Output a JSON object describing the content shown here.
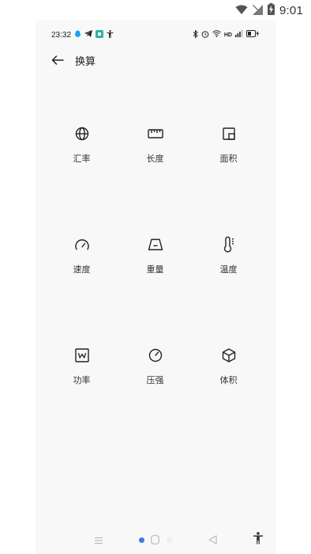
{
  "system_status": {
    "time": "9:01"
  },
  "inner_status": {
    "time": "23:32",
    "network": "HD"
  },
  "header": {
    "title": "换算"
  },
  "converters": [
    {
      "label": "汇率",
      "icon": "globe-icon"
    },
    {
      "label": "长度",
      "icon": "ruler-icon"
    },
    {
      "label": "面积",
      "icon": "area-icon"
    },
    {
      "label": "速度",
      "icon": "speedometer-icon"
    },
    {
      "label": "重量",
      "icon": "weight-icon"
    },
    {
      "label": "温度",
      "icon": "thermometer-icon"
    },
    {
      "label": "功率",
      "icon": "power-icon"
    },
    {
      "label": "压强",
      "icon": "pressure-gauge-icon"
    },
    {
      "label": "体积",
      "icon": "cube-icon"
    }
  ],
  "colors": {
    "background": "#f8f8f8",
    "text": "#222222",
    "accent_dot": "#3b7be0"
  }
}
